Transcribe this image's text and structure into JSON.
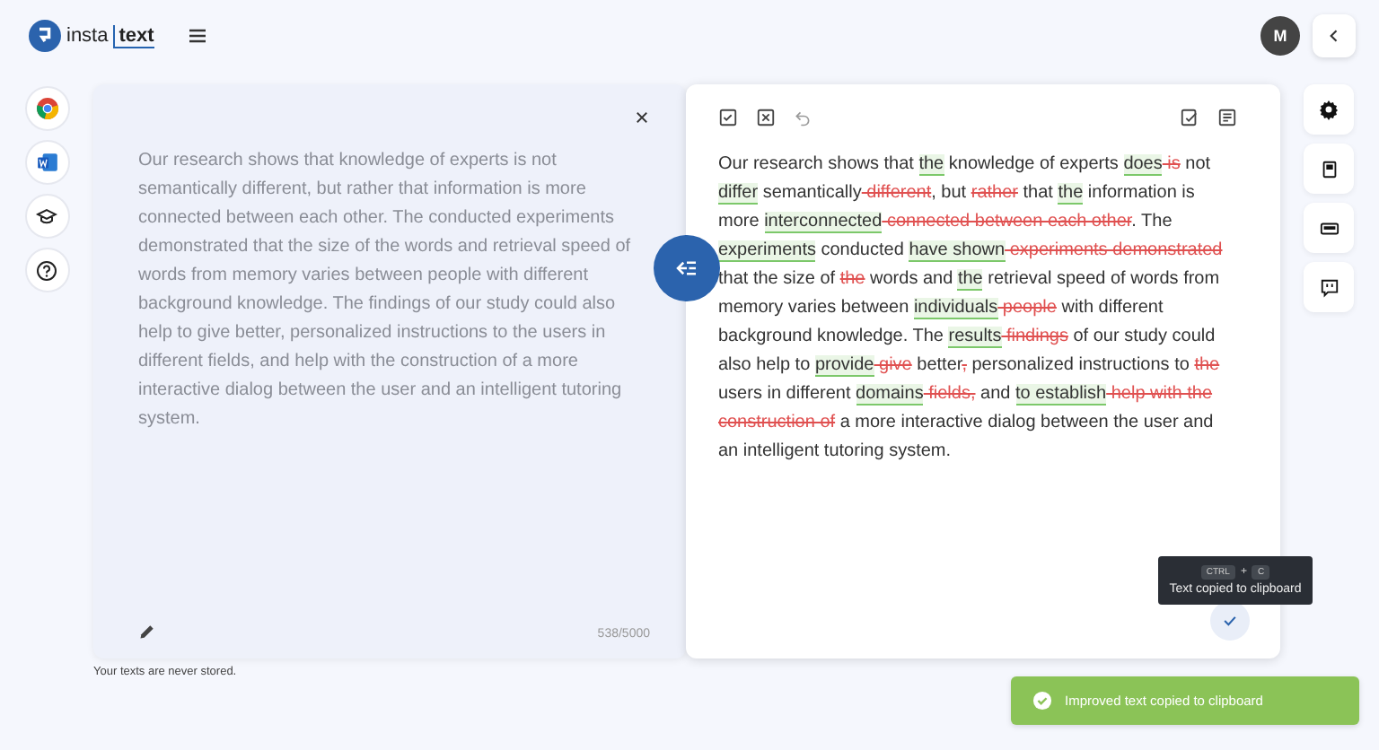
{
  "header": {
    "logo": {
      "part_1": "insta",
      "part_2": "text"
    },
    "avatar": "M"
  },
  "input": {
    "text": "Our research shows that knowledge of experts is not semantically different, but rather that information is more connected between each other. The conducted experiments demonstrated that the size of the words and retrieval speed of words from memory varies between people with different background knowledge. The findings of our study could also help to give better, personalized instructions to the users in different fields, and help with the construction of a more interactive dialog between the user and an intelligent tutoring system.",
    "counter": "538/5000",
    "note": "Your texts are never stored."
  },
  "output": {
    "segments": [
      {
        "kind": "plain",
        "text": "Our research shows that "
      },
      {
        "kind": "added",
        "text": "the"
      },
      {
        "kind": "plain",
        "text": " knowledge of experts "
      },
      {
        "kind": "added",
        "text": "does"
      },
      {
        "kind": "removed",
        "text": " is"
      },
      {
        "kind": "plain",
        "text": " not "
      },
      {
        "kind": "added",
        "text": "differ"
      },
      {
        "kind": "plain",
        "text": " semantically"
      },
      {
        "kind": "removed",
        "text": " different"
      },
      {
        "kind": "plain",
        "text": ", but "
      },
      {
        "kind": "removed",
        "text": "rather"
      },
      {
        "kind": "plain",
        "text": " that "
      },
      {
        "kind": "added",
        "text": "the"
      },
      {
        "kind": "plain",
        "text": " information is more "
      },
      {
        "kind": "added",
        "text": "interconnected"
      },
      {
        "kind": "removed",
        "text": " connected between each other"
      },
      {
        "kind": "plain",
        "text": ". The "
      },
      {
        "kind": "added",
        "text": "experiments"
      },
      {
        "kind": "plain",
        "text": " conducted "
      },
      {
        "kind": "added",
        "text": "have shown"
      },
      {
        "kind": "removed",
        "text": " experiments demonstrated"
      },
      {
        "kind": "plain",
        "text": " that the size of "
      },
      {
        "kind": "removed",
        "text": "the"
      },
      {
        "kind": "plain",
        "text": " words and "
      },
      {
        "kind": "added",
        "text": "the"
      },
      {
        "kind": "plain",
        "text": " retrieval speed of words from memory varies between "
      },
      {
        "kind": "added",
        "text": "individuals"
      },
      {
        "kind": "removed",
        "text": " people"
      },
      {
        "kind": "plain",
        "text": " with different background knowledge. The "
      },
      {
        "kind": "added",
        "text": "results"
      },
      {
        "kind": "removed",
        "text": " findings"
      },
      {
        "kind": "plain",
        "text": " of our study could also help to "
      },
      {
        "kind": "added",
        "text": "provide"
      },
      {
        "kind": "removed",
        "text": " give"
      },
      {
        "kind": "plain",
        "text": " better"
      },
      {
        "kind": "removed",
        "text": ","
      },
      {
        "kind": "plain",
        "text": " personalized instructions to "
      },
      {
        "kind": "removed",
        "text": "the"
      },
      {
        "kind": "plain",
        "text": " users in different "
      },
      {
        "kind": "added",
        "text": "domains"
      },
      {
        "kind": "removed",
        "text": " fields,"
      },
      {
        "kind": "plain",
        "text": " and "
      },
      {
        "kind": "added",
        "text": "to establish"
      },
      {
        "kind": "removed",
        "text": " help with the construction of"
      },
      {
        "kind": "plain",
        "text": " a more interactive dialog between the user and an intelligent tutoring system."
      }
    ]
  },
  "tooltip": {
    "keys": [
      "CTRL",
      "C"
    ],
    "separator": "+",
    "text": "Text copied to clipboard"
  },
  "toast": {
    "text": "Improved text copied to clipboard"
  }
}
